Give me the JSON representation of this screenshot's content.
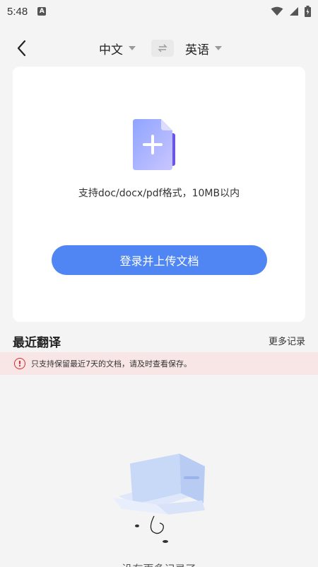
{
  "status_bar": {
    "time": "5:48",
    "notification_icon": "A"
  },
  "header": {
    "source_lang": "中文",
    "target_lang": "英语"
  },
  "upload": {
    "hint": "支持doc/docx/pdf格式，10MB以内",
    "button_label": "登录并上传文档"
  },
  "recent": {
    "title": "最近翻译",
    "more_label": "更多记录",
    "notice": "只支持保留最近7天的文档，请及时查看保存。",
    "empty_text": "没有更多记录了"
  },
  "colors": {
    "accent": "#4f86f3",
    "notice_bg": "#f8e6e6",
    "notice_icon": "#d92a2a"
  }
}
